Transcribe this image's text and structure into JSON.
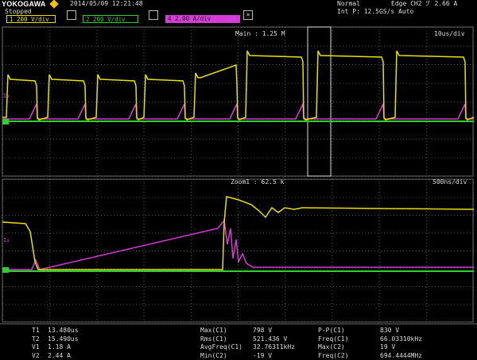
{
  "header": {
    "brand": "YOKOGAWA",
    "datetime": "2014/05/09 12:21:48",
    "state": "Stopped",
    "mode": "Normal",
    "trigger": "Edge CH2 ℱ 2.66 A",
    "acquisition": "Int P: 12.5GS/s  Auto",
    "colors": {
      "ch1": "#e8e000",
      "ch2": "#30d030",
      "ch4": "#d63cd6"
    }
  },
  "channels": [
    {
      "id": "1",
      "label": "200 V/div",
      "color": "#e8e000"
    },
    {
      "id": "2",
      "label": "200 V/div",
      "color": "#30d030"
    },
    {
      "id": "4",
      "label": "2.00 A/div",
      "color": "#d63cd6"
    }
  ],
  "icons": [
    "checkbox-icon",
    "close-icon"
  ],
  "main_panel": {
    "title": "Main : 1.25 M",
    "timebase": "10us/div"
  },
  "zoom_panel": {
    "title": "Zoom1 : 62.5 k",
    "timebase": "500ns/div"
  },
  "cursors": {
    "T1": "13.480us",
    "T2": "15.490us",
    "V1": "1.18 A",
    "V2": "2.44 A"
  },
  "measurements": {
    "col1": [
      {
        "label": "Max(C1)",
        "value": "798 V"
      },
      {
        "label": "Rms(C1)",
        "value": "521.436 V"
      },
      {
        "label": "AvgFreq(C1)",
        "value": "32.76311kHz"
      },
      {
        "label": "Min(C2)",
        "value": "-19 V"
      }
    ],
    "col2": [
      {
        "label": "P-P(C1)",
        "value": "830 V"
      },
      {
        "label": "Freq(C1)",
        "value": "66.03310kHz"
      },
      {
        "label": "Max(C2)",
        "value": "19 V"
      },
      {
        "label": "Freq(C2)",
        "value": "694.4444MHz"
      }
    ]
  }
}
